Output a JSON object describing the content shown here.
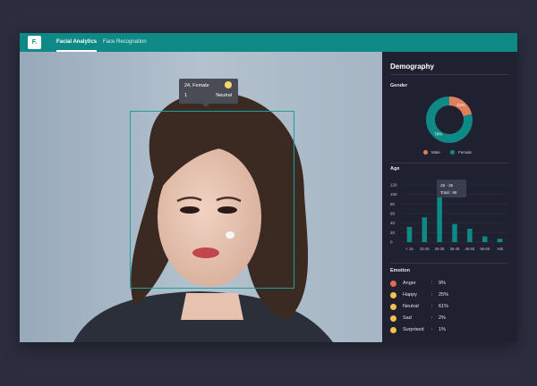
{
  "header": {
    "logo": "F.",
    "tabs": [
      {
        "label": "Facial Analytics",
        "active": true
      },
      {
        "label": "Face Recognation",
        "active": false
      }
    ]
  },
  "tooltip": {
    "line1": "24, Female",
    "face_id": "1",
    "emotion": "Neutral",
    "icon": "neutral-emoji-icon"
  },
  "panel": {
    "title": "Demography",
    "gender": {
      "label": "Gender",
      "male_label": "Male",
      "female_label": "Female",
      "male_pct": "21%",
      "female_pct": "79%"
    },
    "age": {
      "label": "Age"
    },
    "emotion": {
      "label": "Emotion",
      "items": [
        {
          "name": "Anger",
          "value": "9%",
          "color": "#e26b4f"
        },
        {
          "name": "Happy",
          "value": "25%",
          "color": "#f2c14e"
        },
        {
          "name": "Neutral",
          "value": "61%",
          "color": "#f2c14e"
        },
        {
          "name": "Sad",
          "value": "2%",
          "color": "#f2c14e"
        },
        {
          "name": "Surprised",
          "value": "1%",
          "color": "#f2c14e"
        }
      ]
    }
  },
  "colors": {
    "accent": "#0e8985",
    "male": "#e07f5b",
    "female": "#0e8985"
  },
  "chart_data": [
    {
      "type": "pie",
      "categories": [
        "Male",
        "Female"
      ],
      "values": [
        21,
        79
      ],
      "title": "Gender"
    },
    {
      "type": "bar",
      "title": "Age",
      "categories": [
        "< 15",
        "15-25",
        "26-35",
        "36-45",
        "46-55",
        "56-65",
        ">65"
      ],
      "values": [
        32,
        52,
        98,
        38,
        28,
        12,
        7
      ],
      "ylim": [
        0,
        120
      ],
      "yticks": [
        "120",
        "100",
        "80",
        "60",
        "40",
        "20",
        "0"
      ],
      "highlight": {
        "category": "26 - 35",
        "total_label": "Total : 98"
      },
      "grid": true
    }
  ]
}
